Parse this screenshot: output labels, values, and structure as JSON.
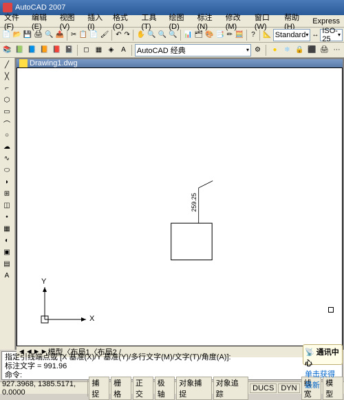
{
  "title": "AutoCAD 2007",
  "menus": [
    "文件(F)",
    "编辑(E)",
    "视图(V)",
    "插入(I)",
    "格式(O)",
    "工具(T)",
    "绘图(D)",
    "标注(N)",
    "修改(M)",
    "窗口(W)",
    "帮助(H)",
    "Express"
  ],
  "workspace_dropdown": "AutoCAD 经典",
  "dimstyle": "Standard",
  "dimscale": "ISO-25",
  "drawing_title": "Drawing1.dwg",
  "dim_value": "259.25",
  "axis_x": "X",
  "axis_y": "Y",
  "tabs_nav": [
    "◄",
    "◄",
    "►",
    "►"
  ],
  "tabs": "模型〈布局1〈布局2 /",
  "cmd_line1": "指定引线端点或 [X 基准(X)/Y 基准(Y)/多行文字(M)/文字(T)/角度(A)]:",
  "cmd_line2": "标注文字 = 991.96",
  "cmd_line3": "命令:",
  "status_coords": "927.3968, 1385.5171, 0.0000",
  "status_btns": [
    "捕捉",
    "栅格",
    "正交",
    "极轴",
    "对象捕捉",
    "对象追踪",
    "DUCS",
    "DYN",
    "线宽",
    "模型"
  ],
  "notif_title": "通讯中心",
  "notif_line": "单击获得最新"
}
